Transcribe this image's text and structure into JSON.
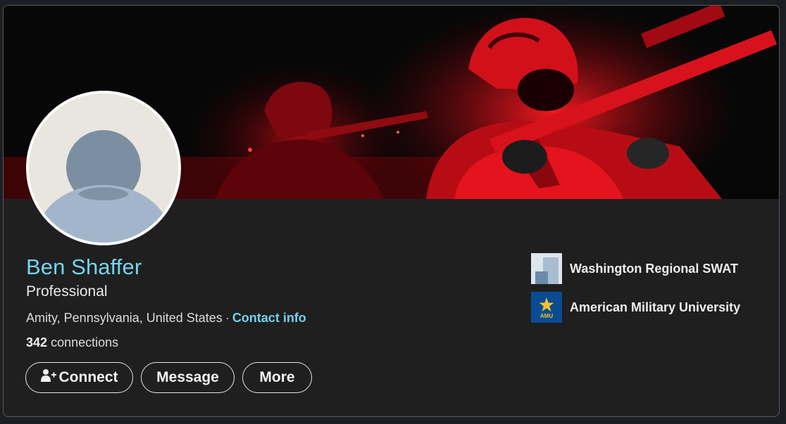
{
  "profile": {
    "name": "Ben Shaffer",
    "headline": "Professional",
    "location": "Amity, Pennsylvania, United States",
    "separator": "·",
    "contact_info_label": "Contact info",
    "connections_count": "342",
    "connections_label": "connections"
  },
  "actions": {
    "connect_label": "Connect",
    "message_label": "Message",
    "more_label": "More"
  },
  "organizations": [
    {
      "name": "Washington Regional SWAT",
      "logo_icon": "building-logo-icon"
    },
    {
      "name": "American Military University",
      "logo_icon": "amu-logo-icon",
      "logo_text": "AMU"
    }
  ],
  "colors": {
    "name": "#74d4ee",
    "link": "#71d1ee",
    "card_background": "#1f1f1f",
    "banner_red": "#e0101a"
  }
}
